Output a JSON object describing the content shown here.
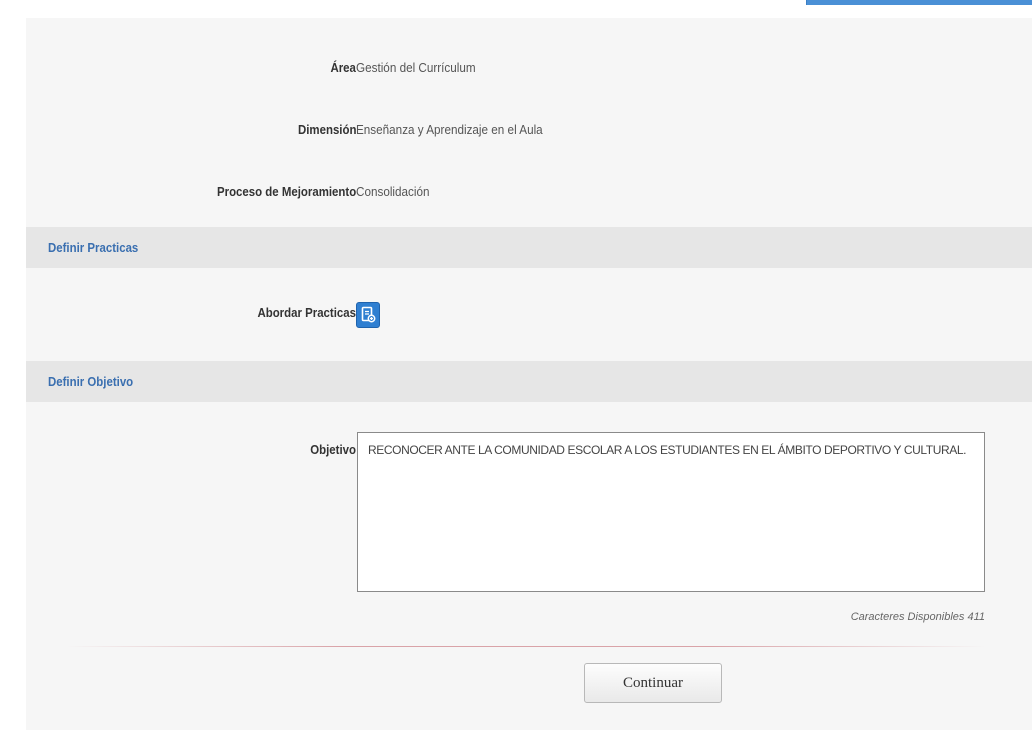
{
  "fields": {
    "area": {
      "label": "Área",
      "value": "Gestión del Currículum"
    },
    "dimension": {
      "label": "Dimensión",
      "value": "Enseñanza y Aprendizaje en el Aula"
    },
    "proceso": {
      "label": "Proceso de Mejoramiento",
      "value": "Consolidación"
    }
  },
  "sections": {
    "practicas": {
      "title": "Definir Practicas",
      "abordar_label": "Abordar Practicas"
    },
    "objetivo": {
      "title": "Definir Objetivo",
      "objetivo_label": "Objetivo",
      "objetivo_value": "RECONOCER ANTE LA COMUNIDAD ESCOLAR A LOS ESTUDIANTES EN EL ÁMBITO DEPORTIVO Y CULTURAL.",
      "counter": "Caracteres Disponibles 411"
    }
  },
  "actions": {
    "continue_label": "Continuar"
  },
  "colors": {
    "section_title": "#3a6fb0",
    "icon_button": "#2f7fd1",
    "section_bar": "#e6e6e6"
  },
  "icons": {
    "abordar": "document-edit-icon"
  }
}
